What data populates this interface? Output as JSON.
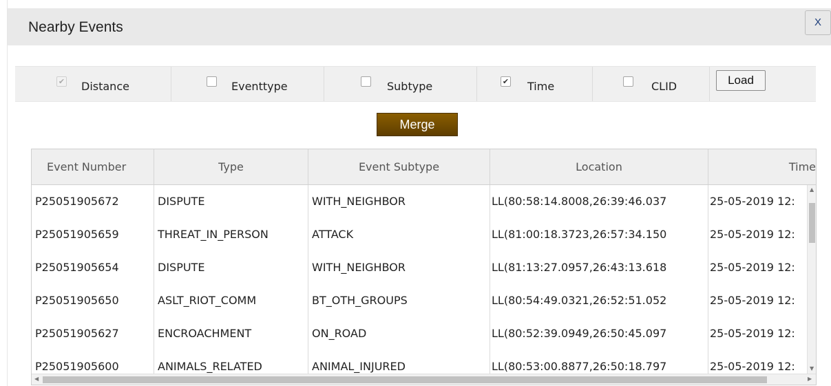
{
  "dialog": {
    "title": "Nearby Events",
    "close_label": "X"
  },
  "filters": [
    {
      "label": "Distance",
      "checked": true,
      "disabled": true
    },
    {
      "label": "Eventtype",
      "checked": false,
      "disabled": false
    },
    {
      "label": "Subtype",
      "checked": false,
      "disabled": false
    },
    {
      "label": "Time",
      "checked": true,
      "disabled": false
    },
    {
      "label": "CLID",
      "checked": false,
      "disabled": false
    }
  ],
  "load_label": "Load",
  "merge_label": "Merge",
  "table": {
    "columns": [
      "Event Number",
      "Type",
      "Event Subtype",
      "Location",
      "Time"
    ],
    "rows": [
      [
        "P25051905672",
        "DISPUTE",
        "WITH_NEIGHBOR",
        "LL(80:58:14.8008,26:39:46.037",
        "25-05-2019 12:"
      ],
      [
        "P25051905659",
        "THREAT_IN_PERSON",
        "ATTACK",
        "LL(81:00:18.3723,26:57:34.150",
        "25-05-2019 12:"
      ],
      [
        "P25051905654",
        "DISPUTE",
        "WITH_NEIGHBOR",
        "LL(81:13:27.0957,26:43:13.618",
        "25-05-2019 12:"
      ],
      [
        "P25051905650",
        "ASLT_RIOT_COMM",
        "BT_OTH_GROUPS",
        "LL(80:54:49.0321,26:52:51.052",
        "25-05-2019 12:"
      ],
      [
        "P25051905627",
        "ENCROACHMENT",
        "ON_ROAD",
        "LL(80:52:39.0949,26:50:45.097",
        "25-05-2019 12:"
      ],
      [
        "P25051905600",
        "ANIMALS_RELATED",
        "ANIMAL_INJURED",
        "LL(80:53:00.8877,26:50:18.797",
        "25-05-2019 12:"
      ]
    ]
  }
}
